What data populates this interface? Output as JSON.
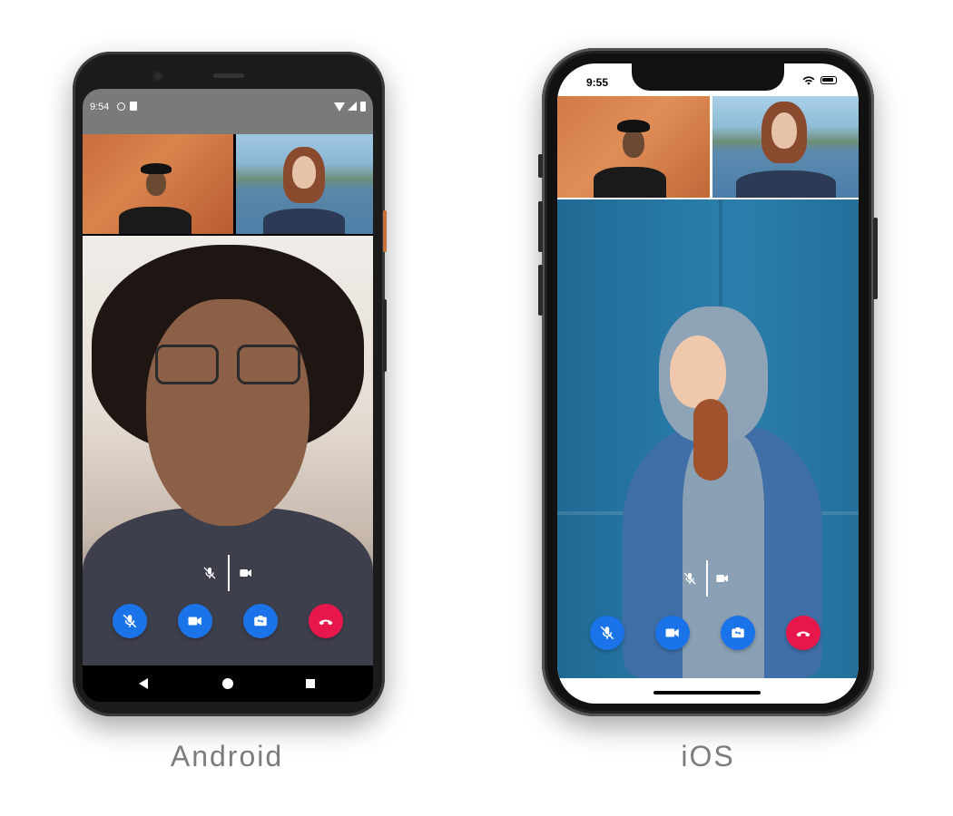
{
  "android": {
    "label": "Android",
    "status_time": "9:54",
    "indicators": {
      "mic_icon": "mic-off-icon",
      "camera_icon": "videocam-icon"
    },
    "buttons": [
      {
        "name": "mute-button",
        "icon": "mic-off-icon",
        "color": "#1a73e8"
      },
      {
        "name": "camera-toggle-button",
        "icon": "videocam-icon",
        "color": "#1a73e8"
      },
      {
        "name": "switch-camera-button",
        "icon": "switch-camera-icon",
        "color": "#1a73e8"
      },
      {
        "name": "end-call-button",
        "icon": "call-end-icon",
        "color": "#e8174b"
      }
    ],
    "nav_icons": [
      "back-icon",
      "home-icon",
      "recents-icon"
    ]
  },
  "ios": {
    "label": "iOS",
    "status_time": "9:55",
    "indicators": {
      "mic_icon": "mic-off-icon",
      "camera_icon": "videocam-icon"
    },
    "buttons": [
      {
        "name": "mute-button",
        "icon": "mic-off-icon",
        "color": "#1a73e8"
      },
      {
        "name": "camera-toggle-button",
        "icon": "videocam-icon",
        "color": "#1a73e8"
      },
      {
        "name": "switch-camera-button",
        "icon": "switch-camera-icon",
        "color": "#1a73e8"
      },
      {
        "name": "end-call-button",
        "icon": "call-end-icon",
        "color": "#e8174b"
      }
    ]
  },
  "colors": {
    "accent": "#1a73e8",
    "danger": "#e8174b",
    "label_gray": "#7c7c7c"
  }
}
